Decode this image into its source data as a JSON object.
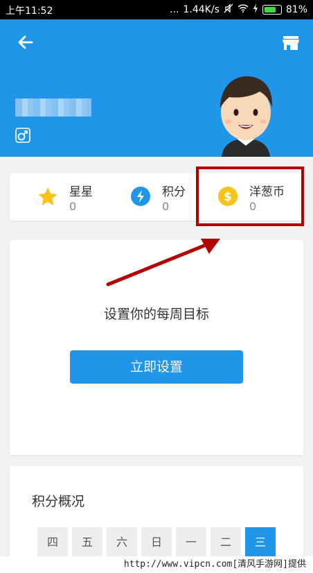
{
  "status_bar": {
    "time": "上午11:52",
    "dots": "...",
    "speed": "1.44K/s",
    "battery_pct": "81%",
    "battery_level": 0.81
  },
  "header": {
    "icons": [
      "back-arrow-icon",
      "store-icon",
      "male-gender-icon"
    ],
    "bg_color": "#2196e8"
  },
  "stats": [
    {
      "label": "星星",
      "value": "0",
      "icon": "star-icon"
    },
    {
      "label": "积分",
      "value": "0",
      "icon": "lightning-icon"
    },
    {
      "label": "洋葱币",
      "value": "0",
      "icon": "dollar-coin-icon"
    }
  ],
  "goal": {
    "title": "设置你的每周目标",
    "button": "立即设置"
  },
  "points": {
    "title": "积分概况",
    "days": [
      "四",
      "五",
      "六",
      "日",
      "一",
      "二",
      "三"
    ],
    "active_day": "三"
  },
  "watermark": "http://www.vipcn.com[清风手游网]提供",
  "colors": {
    "accent": "#2196e8",
    "annotation": "#b30000"
  }
}
